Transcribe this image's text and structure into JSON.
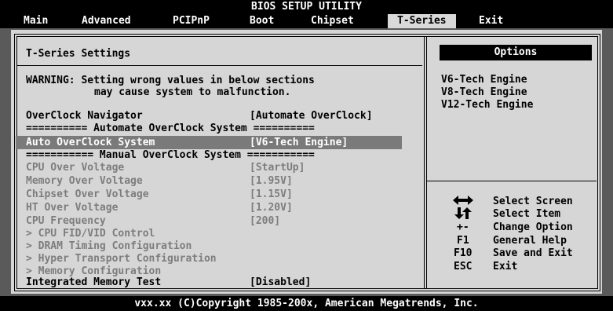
{
  "header": {
    "title": "BIOS SETUP UTILITY",
    "menus": [
      "Main",
      "Advanced",
      "PCIPnP",
      "Boot",
      "Chipset",
      "T-Series",
      "Exit"
    ],
    "active": "T-Series"
  },
  "panel": {
    "title": "T-Series Settings",
    "warning_line1": "WARNING: Setting wrong values in below sections",
    "warning_line2": "may cause system to malfunction.",
    "navigator_label": "OverClock Navigator",
    "navigator_value": "[Automate OverClock]",
    "sep_auto": "========== Automate OverClock System ==========",
    "auto_label": "Auto OverClock System",
    "auto_value": "[V6-Tech Engine]",
    "sep_manual": "=========== Manual OverClock System ===========",
    "cpu_volt_label": "CPU Over Voltage",
    "cpu_volt_value": "[StartUp]",
    "mem_volt_label": "Memory Over Voltage",
    "mem_volt_value": "[1.95V]",
    "chipset_volt_label": "Chipset Over Voltage",
    "chipset_volt_value": "[1.15V]",
    "ht_volt_label": "HT Over Voltage",
    "ht_volt_value": "[1.20V]",
    "cpu_freq_label": "CPU Frequency",
    "cpu_freq_value": "[200]",
    "sub_cpu_fid": "> CPU FID/VID Control",
    "sub_dram": "> DRAM Timing Configuration",
    "sub_ht": "> Hyper Transport Configuration",
    "sub_mem": "> Memory Configuration",
    "mem_test_label": "Integrated Memory Test",
    "mem_test_value": "[Disabled]"
  },
  "options": {
    "title": "Options",
    "items": [
      "V6-Tech Engine",
      "V8-Tech Engine",
      "V12-Tech Engine"
    ]
  },
  "help": {
    "select_screen": "Select Screen",
    "select_item": "Select Item",
    "change_key": "+-",
    "change_option": "Change Option",
    "f1_key": "F1",
    "f1_desc": "General Help",
    "f10_key": "F10",
    "f10_desc": "Save and Exit",
    "esc_key": "ESC",
    "esc_desc": "Exit"
  },
  "footer": "vxx.xx (C)Copyright 1985-200x, American Megatrends, Inc."
}
